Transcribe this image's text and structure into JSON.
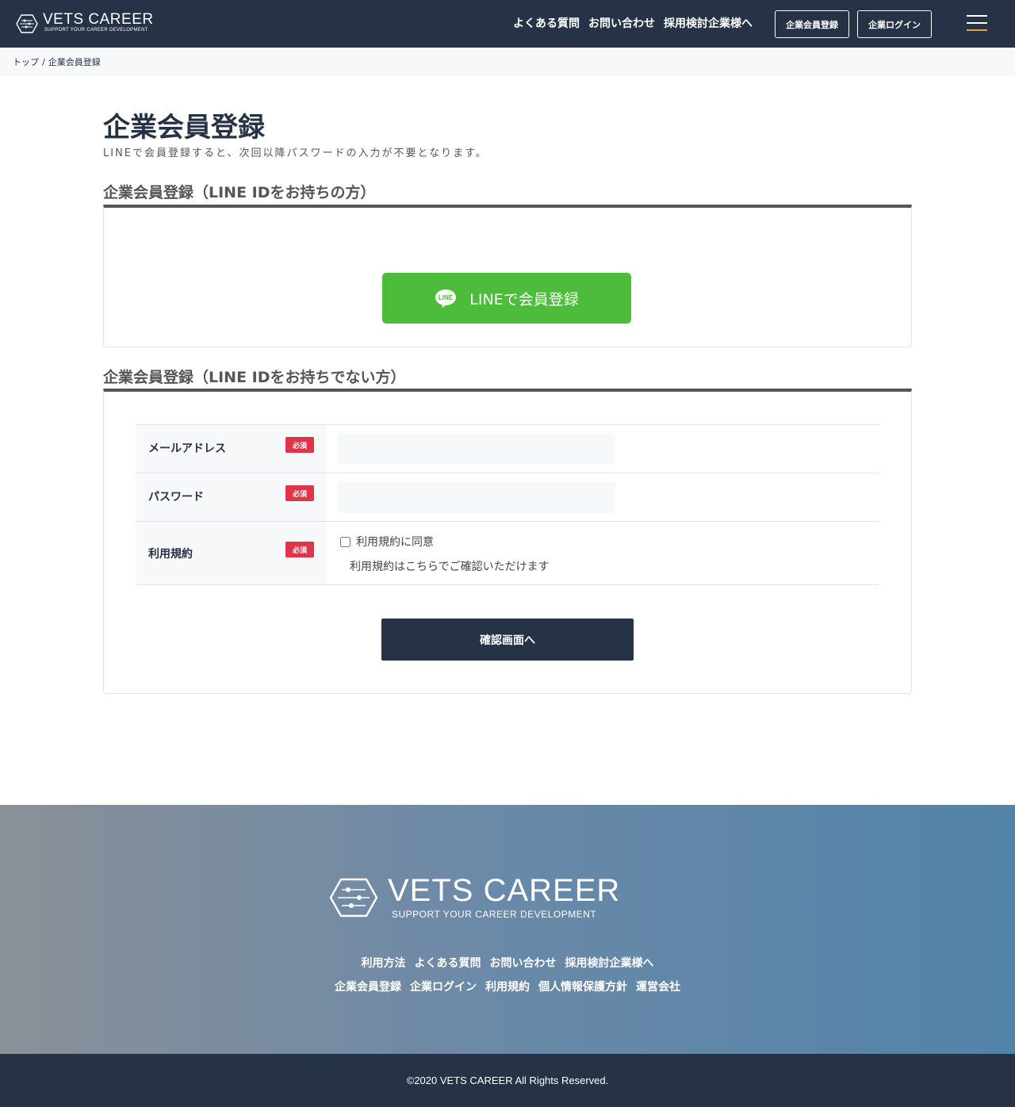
{
  "header": {
    "logo_title": "VETS CAREER",
    "logo_sub": "SUPPORT YOUR CAREER DEVELOPMENT",
    "nav": [
      "よくある質問",
      "お問い合わせ",
      "採用検討企業様へ"
    ],
    "register_label": "企業会員登録",
    "login_label": "企業ログイン",
    "menu_icon": "hamburger-icon"
  },
  "breadcrumb": {
    "home": "トップ",
    "separator": "/",
    "current": "企業会員登録"
  },
  "main": {
    "title": "企業会員登録",
    "lead": "LINEで会員登録すると、次回以降パスワードの入力が不要となります。",
    "line_section": {
      "title": "企業会員登録（LINE IDをお持ちの方）",
      "button_label": "LINEで会員登録",
      "icon_text": "LINE"
    },
    "form_section": {
      "title": "企業会員登録（LINE IDをお持ちでない方）",
      "required_badge": "必須",
      "fields": {
        "email_label": "メールアドレス",
        "email_value": "",
        "password_label": "パスワード",
        "password_value": "",
        "terms_label": "利用規約",
        "terms_checkbox_label": "利用規約に同意",
        "terms_note": "利用規約はこちらでご確認いただけます"
      },
      "submit_label": "確認画面へ"
    }
  },
  "footer": {
    "logo_title": "VETS CAREER",
    "logo_sub": "SUPPORT YOUR CAREER DEVELOPMENT",
    "nav_row1": [
      "利用方法",
      "よくある質問",
      "お問い合わせ",
      "採用検討企業様へ"
    ],
    "nav_row2": [
      "企業会員登録",
      "企業ログイン",
      "利用規約",
      "個人情報保護方針",
      "運営会社"
    ],
    "copyright": "©2020 VETS CAREER All Rights Reserved."
  },
  "colors": {
    "navy": "#263246",
    "line_green": "#4cbc3a",
    "required_red": "#e0344a",
    "menu_accent": "#e8a13a"
  }
}
